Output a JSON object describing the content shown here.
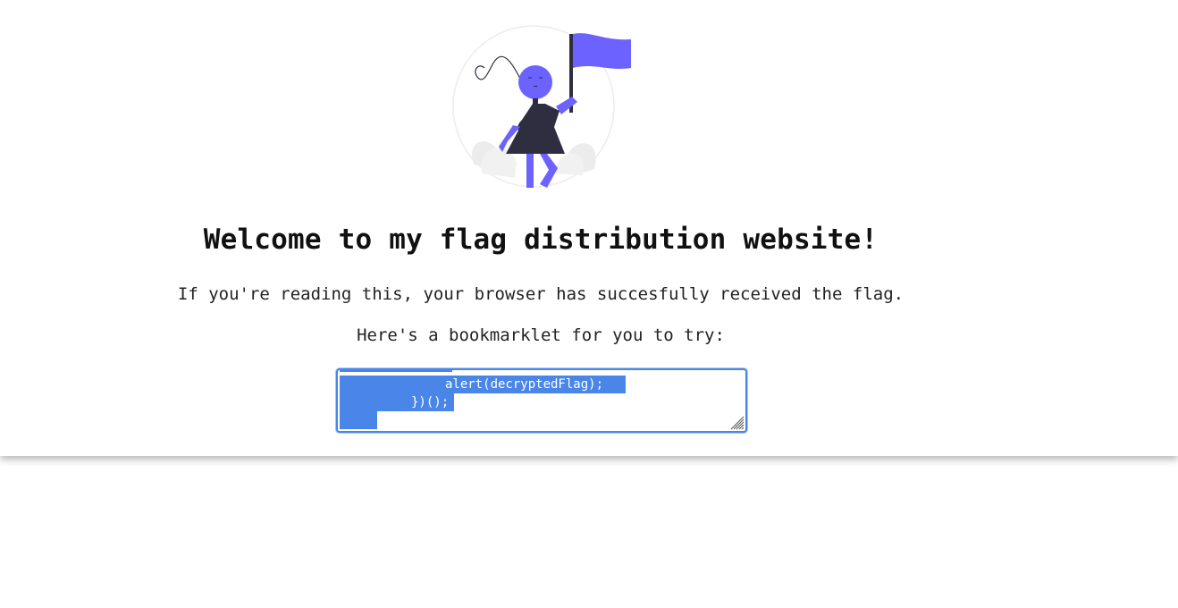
{
  "header": {
    "illustration_icon": "woman-holding-flag-illustration",
    "accent_color": "#6c63ff",
    "title": "Welcome to my flag distribution website!"
  },
  "main": {
    "message": "If you're reading this, your browser has succesfully received the flag.",
    "bookmarklet_prompt": "Here's a bookmarklet for you to try:",
    "bookmarklet_code_visible_lines": [
      "alert(decryptedFlag);",
      "})();"
    ],
    "selection_color": "#4a86e8"
  }
}
